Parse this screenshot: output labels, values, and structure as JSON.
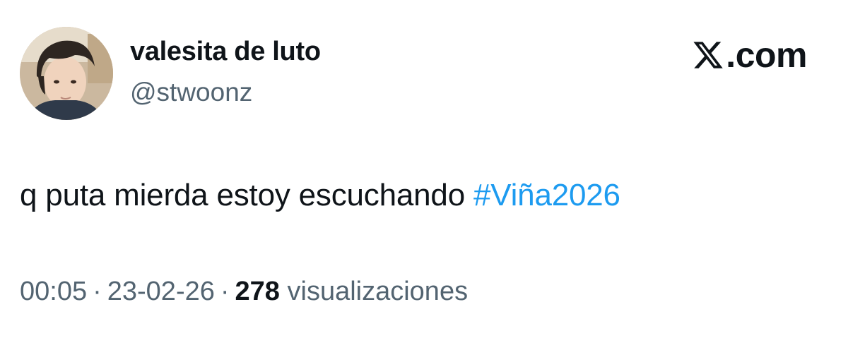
{
  "user": {
    "display_name": "valesita de luto",
    "handle": "@stwoonz"
  },
  "brand": {
    "icon": "x-logo-icon",
    "text": ".com"
  },
  "tweet": {
    "text": "q puta mierda estoy escuchando ",
    "hashtag": "#Viña2026"
  },
  "meta": {
    "time": "00:05",
    "separator": "·",
    "date": "23-02-26",
    "views_count": "278",
    "views_label": "visualizaciones"
  },
  "colors": {
    "text": "#0f1419",
    "secondary": "#536471",
    "accent": "#1d9bf0",
    "background": "#ffffff"
  }
}
